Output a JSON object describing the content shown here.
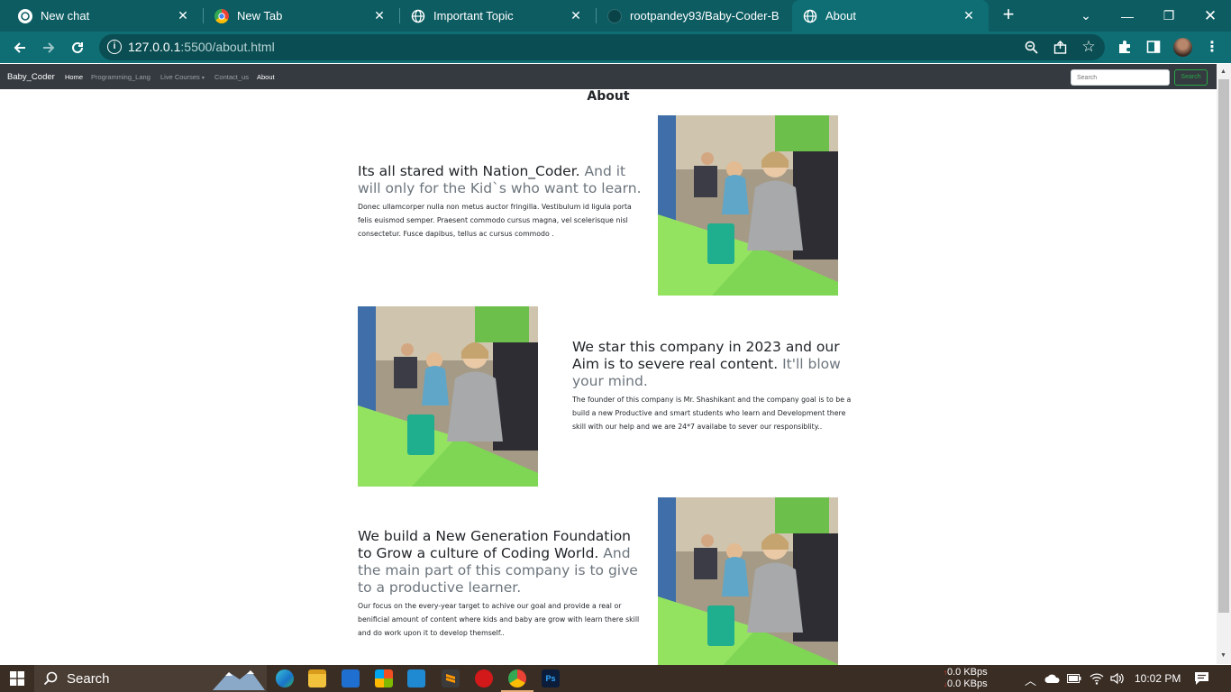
{
  "browser": {
    "tabs": [
      {
        "title": "New chat",
        "icon": "chatgpt-icon"
      },
      {
        "title": "New Tab",
        "icon": "chrome-icon"
      },
      {
        "title": "Important Topic",
        "icon": "globe-icon"
      },
      {
        "title": "rootpandey93/Baby-Coder-B",
        "icon": "github-icon"
      },
      {
        "title": "About",
        "icon": "globe-icon",
        "active": true
      }
    ],
    "url_host": "127.0.0.1",
    "url_path": ":5500/about.html",
    "accent": "#0e6e74"
  },
  "navbar": {
    "brand": "Baby_Coder",
    "links": [
      "Home",
      "Programming_Lang",
      "Live Courses",
      "Contact_us",
      "About"
    ],
    "search_placeholder": "Search",
    "search_button": "Search"
  },
  "page": {
    "title": "About",
    "features": [
      {
        "heading": "Its all stared with Nation_Coder.",
        "heading_muted": "And it will only for the Kid`s who want to learn.",
        "text": "Donec ullamcorper nulla non metus auctor fringilla. Vestibulum id ligula porta felis euismod semper. Praesent commodo cursus magna, vel scelerisque nisl consectetur. Fusce dapibus, tellus ac cursus commodo ."
      },
      {
        "heading": "We star this company in 2023 and our Aim is to severe real content.",
        "heading_muted": "It'll blow your mind.",
        "text": "The founder of this company is Mr. Shashikant and the company goal is to be a build a new Productive and smart students who learn and Development there skill with our help and we are 24*7 availabe to sever our responsiblity.."
      },
      {
        "heading": "We build a New Generation Foundation to Grow a culture of Coding World.",
        "heading_muted": "And the main part of this company is to give to a productive learner.",
        "text": "Our focus on the every-year target to achive our goal and provide a real or benificial amount of content where kids and baby are grow with learn there skill and do work upon it to develop themself.."
      }
    ]
  },
  "taskbar": {
    "search_label": "Search",
    "net_up": "0.0 KBps",
    "net_down": "0.0 KBps",
    "time": "10:02 PM"
  }
}
